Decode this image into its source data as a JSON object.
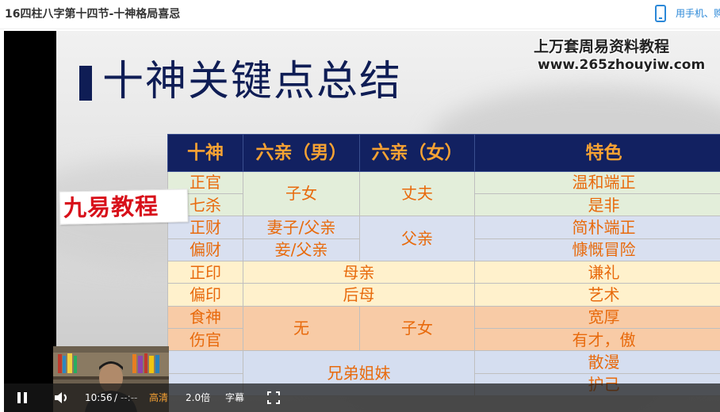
{
  "page": {
    "title": "16四柱八字第十四节-十神格局喜忌",
    "mobile_link": "用手机、购"
  },
  "slide": {
    "heading": "十神关键点总结",
    "watermark_line1": "上万套周易资料教程",
    "watermark_line2": "www.265zhouyiw.com",
    "logo_text": "九易教程"
  },
  "table": {
    "headers": [
      "十神",
      "六亲（男）",
      "六亲（女）",
      "特色"
    ],
    "rows": [
      {
        "god": "正官",
        "trait": "温和端正"
      },
      {
        "god": "七杀",
        "trait": "是非"
      },
      {
        "god": "正财",
        "trait": "简朴端正"
      },
      {
        "god": "偏财",
        "trait": "慷慨冒险"
      },
      {
        "god": "正印",
        "trait": "谦礼"
      },
      {
        "god": "偏印",
        "trait": "艺术"
      },
      {
        "god": "食神",
        "trait": "宽厚"
      },
      {
        "god": "伤官",
        "trait": "有才，傲"
      },
      {
        "god": "",
        "trait": "散漫"
      },
      {
        "god": "",
        "trait": "护己"
      }
    ],
    "relations": {
      "guan_male": "子女",
      "guan_female": "丈夫",
      "zhengcai_male": "妻子/父亲",
      "piancai_male": "妾/父亲",
      "cai_female": "父亲",
      "zhengyin": "母亲",
      "pianyin": "后母",
      "shishang_male": "无",
      "shishang_female": "子女",
      "bijie": "兄弟姐妹"
    }
  },
  "controls": {
    "time": "10:56",
    "separator": "/",
    "duration": "--:--",
    "quality": "高清",
    "speed": "2.0倍",
    "subtitle": "字幕"
  },
  "colors": {
    "table_header": "#122161",
    "cell_text": "#e86a0c",
    "logo_red": "#d8101a",
    "link_blue": "#2b88d8"
  }
}
